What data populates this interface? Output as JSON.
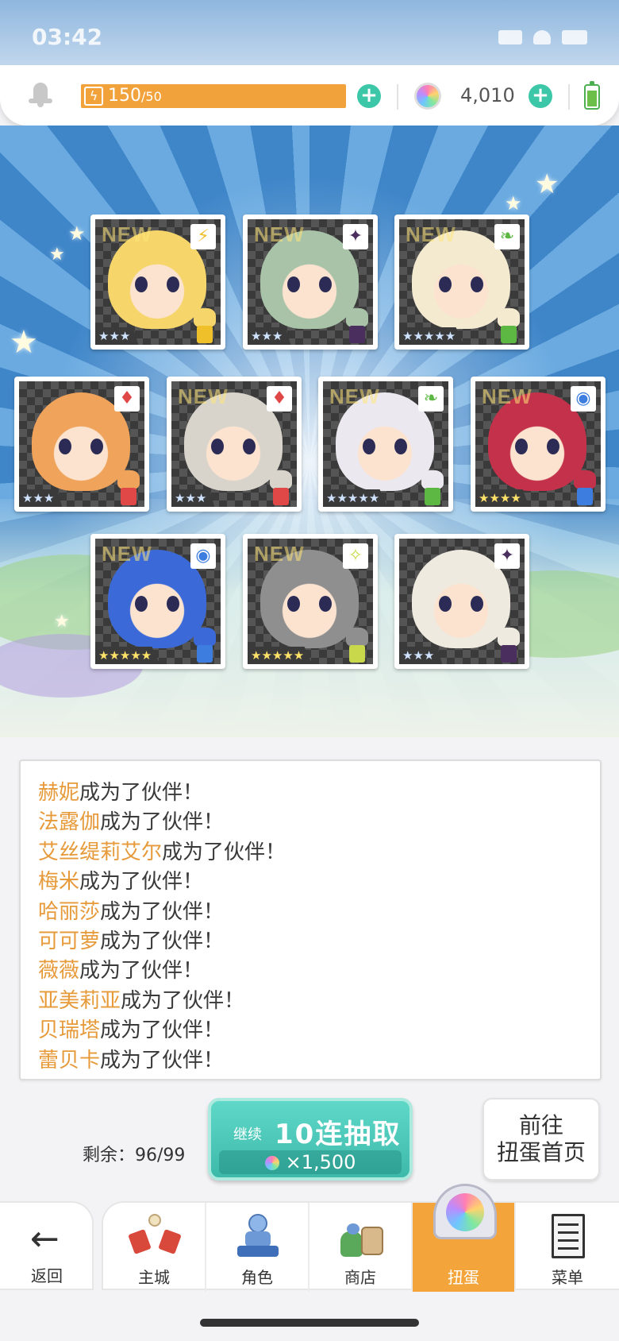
{
  "status_bar": {
    "time": "03:42"
  },
  "resources": {
    "stamina_current": "150",
    "stamina_max": "/50",
    "gems": "4,010"
  },
  "cards": [
    {
      "new": "NEW",
      "element": "⚡",
      "element_color": "#f0c02a",
      "stars": "★★★",
      "gold": false,
      "skin": "#f6d56a"
    },
    {
      "new": "NEW",
      "element": "✦",
      "element_color": "#4a2f5e",
      "stars": "★★★",
      "gold": false,
      "skin": "#a9c3a8"
    },
    {
      "new": "NEW",
      "element": "❧",
      "element_color": "#5cb843",
      "stars": "★★★★★",
      "gold": false,
      "skin": "#f3ead0"
    },
    {
      "new": "",
      "element": "♦",
      "element_color": "#e04848",
      "stars": "★★★",
      "gold": false,
      "skin": "#f0a35a"
    },
    {
      "new": "NEW",
      "element": "♦",
      "element_color": "#e04848",
      "stars": "★★★",
      "gold": false,
      "skin": "#d8d4cc"
    },
    {
      "new": "NEW",
      "element": "❧",
      "element_color": "#5cb843",
      "stars": "★★★★★",
      "gold": false,
      "skin": "#ece8f0"
    },
    {
      "new": "NEW",
      "element": "◉",
      "element_color": "#3d7de0",
      "stars": "★★★★",
      "gold": true,
      "skin": "#c3324a"
    },
    {
      "new": "NEW",
      "element": "◉",
      "element_color": "#3d7de0",
      "stars": "★★★★★",
      "gold": true,
      "skin": "#3b6ad8"
    },
    {
      "new": "NEW",
      "element": "✧",
      "element_color": "#c8d84a",
      "stars": "★★★★★",
      "gold": true,
      "skin": "#8f8f8f"
    },
    {
      "new": "",
      "element": "✦",
      "element_color": "#4a2f5e",
      "stars": "★★★",
      "gold": false,
      "skin": "#efeadf"
    }
  ],
  "log": [
    {
      "name": "赫妮",
      "text": "成为了伙伴！"
    },
    {
      "name": "法露伽",
      "text": "成为了伙伴！"
    },
    {
      "name": "艾丝缇莉艾尔",
      "text": "成为了伙伴！"
    },
    {
      "name": "梅米",
      "text": "成为了伙伴！"
    },
    {
      "name": "哈丽莎",
      "text": "成为了伙伴！"
    },
    {
      "name": "可可萝",
      "text": "成为了伙伴！"
    },
    {
      "name": "薇薇",
      "text": "成为了伙伴！"
    },
    {
      "name": "亚美莉亚",
      "text": "成为了伙伴！"
    },
    {
      "name": "贝瑞塔",
      "text": "成为了伙伴！"
    },
    {
      "name": "蕾贝卡",
      "text": "成为了伙伴！"
    }
  ],
  "actions": {
    "remaining": "剩余：96/99",
    "continue_label": "继续",
    "pull_label": "10连抽取",
    "pull_cost": "×1,500",
    "home_line1": "前往",
    "home_line2": "扭蛋首页"
  },
  "nav": {
    "back": "返回",
    "tabs": [
      "主城",
      "角色",
      "商店",
      "扭蛋",
      "菜单"
    ],
    "active": 3
  },
  "colors": {
    "accent_orange": "#f3a53b",
    "accent_teal": "#3db9aa",
    "name_orange": "#e69a3a"
  }
}
